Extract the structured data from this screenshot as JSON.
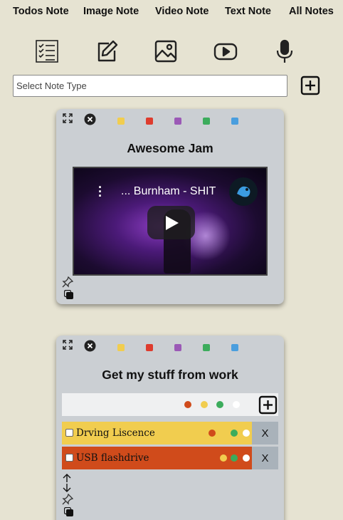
{
  "nav": {
    "items": [
      "Todos Note",
      "Image Note",
      "Video Note",
      "Text Note",
      "All Notes"
    ]
  },
  "toolbar": {
    "icons": [
      "checklist-icon",
      "edit-icon",
      "image-icon",
      "video-icon",
      "microphone-icon"
    ]
  },
  "note_type_select": {
    "value": "Select Note Type"
  },
  "colors": {
    "background": "#e6e3d2",
    "card": "#cbcfd3",
    "yellow": "#f1cd4f",
    "red": "#de3c2e",
    "purple": "#9b59b6",
    "green": "#3cac5c",
    "blue": "#4a9ede",
    "orange": "#d04b1b"
  },
  "video_note": {
    "title": "Awesome Jam",
    "video_title": "... Burnham - SHIT"
  },
  "todo_note": {
    "title": "Get my stuff from work",
    "items": [
      {
        "text": "Drving Liscence",
        "delete_label": "X"
      },
      {
        "text": "USB flashdrive",
        "delete_label": "X"
      }
    ]
  }
}
